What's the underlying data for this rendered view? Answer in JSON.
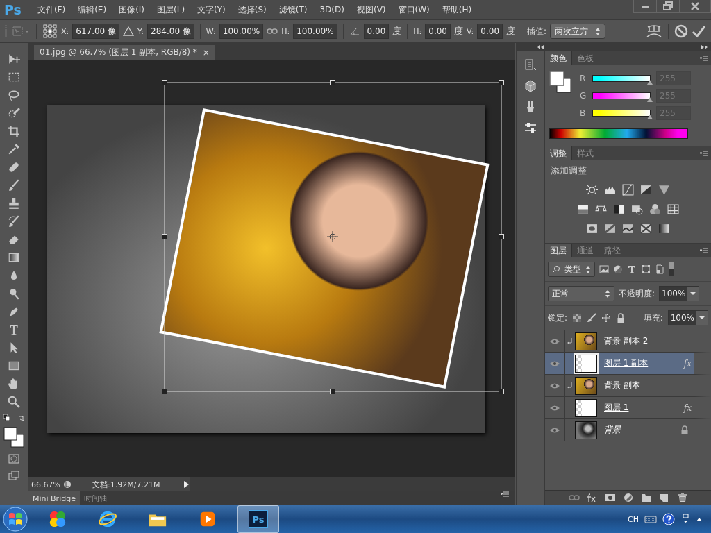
{
  "app_logo": "Ps",
  "menu": [
    "文件(F)",
    "编辑(E)",
    "图像(I)",
    "图层(L)",
    "文字(Y)",
    "选择(S)",
    "滤镜(T)",
    "3D(D)",
    "视图(V)",
    "窗口(W)",
    "帮助(H)"
  ],
  "options": {
    "x": {
      "label": "X:",
      "value": "617.00 像"
    },
    "y": {
      "label": "Y:",
      "value": "284.00 像"
    },
    "w": {
      "label": "W:",
      "value": "100.00%"
    },
    "h": {
      "label": "H:",
      "value": "100.00%"
    },
    "angle": {
      "value": "0.00",
      "unit": "度"
    },
    "skew_h": {
      "label": "H:",
      "value": "0.00",
      "unit": "度"
    },
    "skew_v": {
      "label": "V:",
      "value": "0.00",
      "unit": "度"
    },
    "interpolation": {
      "label": "插值:",
      "value": "两次立方"
    }
  },
  "document_tab": {
    "title": "01.jpg @ 66.7% (图层 1 副本, RGB/8) *",
    "close": "×"
  },
  "status_bar": {
    "zoom": "66.67%",
    "doc_info": "文档:1.92M/7.21M"
  },
  "bottom_tabs": [
    {
      "label": "Mini Bridge",
      "selected": true
    },
    {
      "label": "时间轴",
      "selected": false
    }
  ],
  "color_panel": {
    "tabs": [
      {
        "label": "颜色",
        "selected": true
      },
      {
        "label": "色板",
        "selected": false
      }
    ],
    "channels": [
      {
        "label": "R",
        "color": "#00ffff",
        "level": 1,
        "value": "255"
      },
      {
        "label": "G",
        "color": "#ff00ff",
        "level": 1,
        "value": "255"
      },
      {
        "label": "B",
        "color": "#ffff00",
        "level": 1,
        "value": "255"
      }
    ]
  },
  "adjustments_panel": {
    "tabs": [
      {
        "label": "调整",
        "selected": true
      },
      {
        "label": "样式",
        "selected": false
      }
    ],
    "title": "添加调整"
  },
  "layers_panel": {
    "tabs": [
      {
        "label": "图层",
        "selected": true
      },
      {
        "label": "通道",
        "selected": false
      },
      {
        "label": "路径",
        "selected": false
      }
    ],
    "filter": "类型",
    "blend_mode": "正常",
    "opacity_label": "不透明度:",
    "opacity": "100%",
    "lock_label": "锁定:",
    "fill_label": "填充:",
    "fill": "100%",
    "layers": [
      {
        "name": "背景 副本 2",
        "kind": "photo",
        "visible": true,
        "selected": false,
        "clipped": true,
        "clipping_base": false,
        "locked": false
      },
      {
        "name": "图层 1 副本",
        "kind": "shape",
        "visible": true,
        "selected": true,
        "clipped": false,
        "clipping_base": true,
        "locked": false,
        "effects": "fx"
      },
      {
        "name": "背景 副本",
        "kind": "photo",
        "visible": true,
        "selected": false,
        "clipped": true,
        "clipping_base": false,
        "locked": false
      },
      {
        "name": "图层 1",
        "kind": "shape",
        "visible": true,
        "selected": false,
        "clipped": false,
        "clipping_base": true,
        "locked": false,
        "effects": "fx"
      },
      {
        "name": "背景",
        "kind": "background",
        "visible": true,
        "selected": false,
        "clipped": false,
        "clipping_base": false,
        "locked": true
      }
    ]
  },
  "taskbar": {
    "apps": [
      {
        "kind": "colorful",
        "selected": false
      },
      {
        "kind": "browser",
        "selected": false
      },
      {
        "kind": "folder",
        "selected": false
      },
      {
        "kind": "media",
        "selected": false
      },
      {
        "kind": "photoshop",
        "label": "Ps",
        "selected": true
      }
    ],
    "tray_language": "CH"
  }
}
